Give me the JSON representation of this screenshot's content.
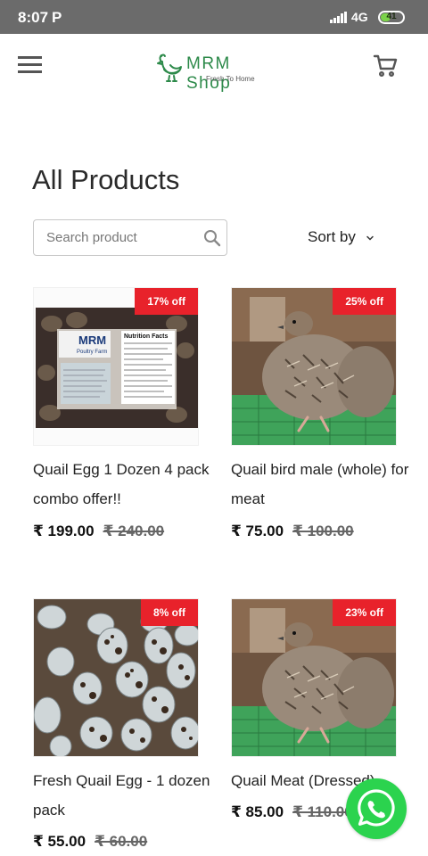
{
  "status_bar": {
    "time": "8:07",
    "carrier_icon": "P",
    "network": "4G",
    "battery": "41",
    "battery_level": 0.41
  },
  "header": {
    "brand": "MRM Shop",
    "tagline": "Fresh To Home",
    "logo_icon": "hen-icon",
    "menu_icon": "hamburger-icon",
    "cart_icon": "cart-icon"
  },
  "page": {
    "title": "All Products"
  },
  "search": {
    "placeholder": "Search product",
    "value": ""
  },
  "sort": {
    "label": "Sort by"
  },
  "products": [
    {
      "name": "Quail Egg 1 Dozen 4 pack combo offer!!",
      "price": "₹ 199.00",
      "old_price": "₹ 240.00",
      "discount": "17% off"
    },
    {
      "name": "Quail bird male (whole) for meat",
      "price": "₹ 75.00",
      "old_price": "₹ 100.00",
      "discount": "25% off"
    },
    {
      "name": "Fresh Quail Egg - 1 dozen pack",
      "price": "₹ 55.00",
      "old_price": "₹ 60.00",
      "discount": "8% off"
    },
    {
      "name": "Quail Meat (Dressed)",
      "price": "₹ 85.00",
      "old_price": "₹ 110.00",
      "discount": "23% off"
    }
  ],
  "product_image_text": {
    "box_brand": "MRM",
    "box_sub": "Poultry Farm",
    "label_heading": "Nutrition Facts"
  },
  "colors": {
    "accent_green": "#2d8a4a",
    "badge_red": "#e8222b",
    "whatsapp_green": "#2bd34e",
    "status_bar": "#6b6b6b"
  },
  "floating": {
    "whatsapp_icon": "whatsapp-icon"
  }
}
